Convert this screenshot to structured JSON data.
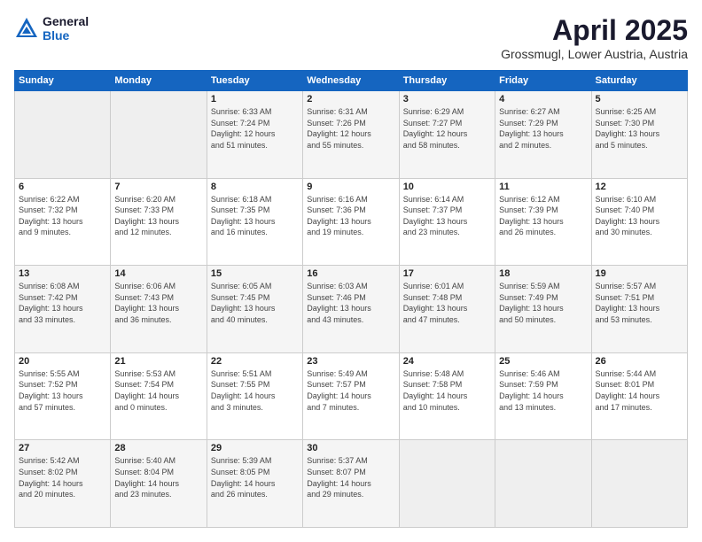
{
  "header": {
    "logo_line1": "General",
    "logo_line2": "Blue",
    "month_year": "April 2025",
    "location": "Grossmugl, Lower Austria, Austria"
  },
  "weekdays": [
    "Sunday",
    "Monday",
    "Tuesday",
    "Wednesday",
    "Thursday",
    "Friday",
    "Saturday"
  ],
  "weeks": [
    [
      {
        "day": "",
        "text": ""
      },
      {
        "day": "",
        "text": ""
      },
      {
        "day": "1",
        "text": "Sunrise: 6:33 AM\nSunset: 7:24 PM\nDaylight: 12 hours\nand 51 minutes."
      },
      {
        "day": "2",
        "text": "Sunrise: 6:31 AM\nSunset: 7:26 PM\nDaylight: 12 hours\nand 55 minutes."
      },
      {
        "day": "3",
        "text": "Sunrise: 6:29 AM\nSunset: 7:27 PM\nDaylight: 12 hours\nand 58 minutes."
      },
      {
        "day": "4",
        "text": "Sunrise: 6:27 AM\nSunset: 7:29 PM\nDaylight: 13 hours\nand 2 minutes."
      },
      {
        "day": "5",
        "text": "Sunrise: 6:25 AM\nSunset: 7:30 PM\nDaylight: 13 hours\nand 5 minutes."
      }
    ],
    [
      {
        "day": "6",
        "text": "Sunrise: 6:22 AM\nSunset: 7:32 PM\nDaylight: 13 hours\nand 9 minutes."
      },
      {
        "day": "7",
        "text": "Sunrise: 6:20 AM\nSunset: 7:33 PM\nDaylight: 13 hours\nand 12 minutes."
      },
      {
        "day": "8",
        "text": "Sunrise: 6:18 AM\nSunset: 7:35 PM\nDaylight: 13 hours\nand 16 minutes."
      },
      {
        "day": "9",
        "text": "Sunrise: 6:16 AM\nSunset: 7:36 PM\nDaylight: 13 hours\nand 19 minutes."
      },
      {
        "day": "10",
        "text": "Sunrise: 6:14 AM\nSunset: 7:37 PM\nDaylight: 13 hours\nand 23 minutes."
      },
      {
        "day": "11",
        "text": "Sunrise: 6:12 AM\nSunset: 7:39 PM\nDaylight: 13 hours\nand 26 minutes."
      },
      {
        "day": "12",
        "text": "Sunrise: 6:10 AM\nSunset: 7:40 PM\nDaylight: 13 hours\nand 30 minutes."
      }
    ],
    [
      {
        "day": "13",
        "text": "Sunrise: 6:08 AM\nSunset: 7:42 PM\nDaylight: 13 hours\nand 33 minutes."
      },
      {
        "day": "14",
        "text": "Sunrise: 6:06 AM\nSunset: 7:43 PM\nDaylight: 13 hours\nand 36 minutes."
      },
      {
        "day": "15",
        "text": "Sunrise: 6:05 AM\nSunset: 7:45 PM\nDaylight: 13 hours\nand 40 minutes."
      },
      {
        "day": "16",
        "text": "Sunrise: 6:03 AM\nSunset: 7:46 PM\nDaylight: 13 hours\nand 43 minutes."
      },
      {
        "day": "17",
        "text": "Sunrise: 6:01 AM\nSunset: 7:48 PM\nDaylight: 13 hours\nand 47 minutes."
      },
      {
        "day": "18",
        "text": "Sunrise: 5:59 AM\nSunset: 7:49 PM\nDaylight: 13 hours\nand 50 minutes."
      },
      {
        "day": "19",
        "text": "Sunrise: 5:57 AM\nSunset: 7:51 PM\nDaylight: 13 hours\nand 53 minutes."
      }
    ],
    [
      {
        "day": "20",
        "text": "Sunrise: 5:55 AM\nSunset: 7:52 PM\nDaylight: 13 hours\nand 57 minutes."
      },
      {
        "day": "21",
        "text": "Sunrise: 5:53 AM\nSunset: 7:54 PM\nDaylight: 14 hours\nand 0 minutes."
      },
      {
        "day": "22",
        "text": "Sunrise: 5:51 AM\nSunset: 7:55 PM\nDaylight: 14 hours\nand 3 minutes."
      },
      {
        "day": "23",
        "text": "Sunrise: 5:49 AM\nSunset: 7:57 PM\nDaylight: 14 hours\nand 7 minutes."
      },
      {
        "day": "24",
        "text": "Sunrise: 5:48 AM\nSunset: 7:58 PM\nDaylight: 14 hours\nand 10 minutes."
      },
      {
        "day": "25",
        "text": "Sunrise: 5:46 AM\nSunset: 7:59 PM\nDaylight: 14 hours\nand 13 minutes."
      },
      {
        "day": "26",
        "text": "Sunrise: 5:44 AM\nSunset: 8:01 PM\nDaylight: 14 hours\nand 17 minutes."
      }
    ],
    [
      {
        "day": "27",
        "text": "Sunrise: 5:42 AM\nSunset: 8:02 PM\nDaylight: 14 hours\nand 20 minutes."
      },
      {
        "day": "28",
        "text": "Sunrise: 5:40 AM\nSunset: 8:04 PM\nDaylight: 14 hours\nand 23 minutes."
      },
      {
        "day": "29",
        "text": "Sunrise: 5:39 AM\nSunset: 8:05 PM\nDaylight: 14 hours\nand 26 minutes."
      },
      {
        "day": "30",
        "text": "Sunrise: 5:37 AM\nSunset: 8:07 PM\nDaylight: 14 hours\nand 29 minutes."
      },
      {
        "day": "",
        "text": ""
      },
      {
        "day": "",
        "text": ""
      },
      {
        "day": "",
        "text": ""
      }
    ]
  ]
}
